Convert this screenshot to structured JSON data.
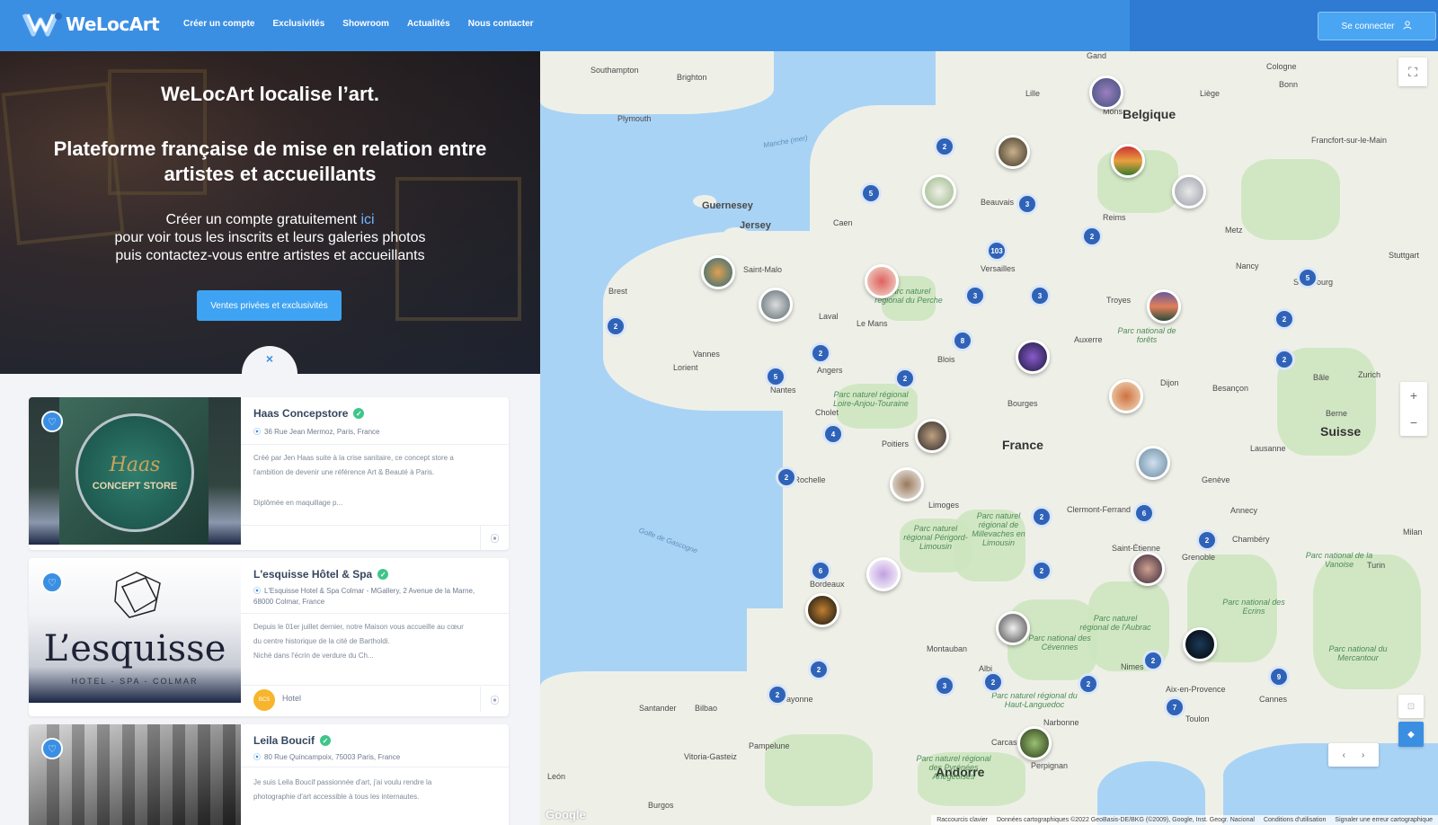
{
  "header": {
    "logo_text": "WeLocArt",
    "nav": [
      "Créer un compte",
      "Exclusivités",
      "Showroom",
      "Actualités",
      "Nous contacter"
    ],
    "login_label": "Se connecter",
    "brand_color": "#3b8fe3"
  },
  "hero": {
    "title": "WeLocArt localise l’art.",
    "subtitle": "Plateforme française de mise en relation entre artistes et accueillants",
    "line1_prefix": "Créer un compte gratuitement ",
    "line1_link": "ici",
    "line2": "pour voir tous les inscrits et leurs galeries photos",
    "line3": "puis contactez-vous entre artistes et accueillants",
    "cta_label": "Ventes privées et exclusivités",
    "close_icon": "×"
  },
  "listings": [
    {
      "name": "Haas Concepstore",
      "address": "36 Rue Jean Mermoz, Paris, France",
      "desc1": "Créé par Jen Haas suite à la crise sanitaire, ce concept store a",
      "desc2": "l'ambition de devenir une référence Art & Beauté à Paris.",
      "desc3": "Diplômée en maquillage p...",
      "image_text": "Haas",
      "image_text2": "CONCEPT STORE"
    },
    {
      "name": "L'esquisse Hôtel & Spa",
      "address": "L'Esquisse Hotel & Spa Colmar - MGallery, 2 Avenue de la Marne, 68000 Colmar, France",
      "desc1": "Depuis le 01er juillet dernier, notre Maison vous accueille au cœur",
      "desc2": "du centre historique de la cité de Bartholdi.",
      "desc3": "Niché dans l'écrin de verdure du Ch...",
      "category": "Hotel",
      "category_badge": "BCS",
      "image_text": "L’esquisse",
      "image_text2": "HOTEL - SPA - COLMAR"
    },
    {
      "name": "Leila Boucif",
      "address": "80 Rue Quincampoix, 75003 Paris, France",
      "desc1": "Je suis Leila Boucif passionnée d'art, j'ai voulu rendre la",
      "desc2": "photographie d'art accessible à tous les internautes."
    }
  ],
  "map": {
    "labels": {
      "france": "France",
      "belgique": "Belgique",
      "suisse": "Suisse",
      "andorre": "Andorre",
      "guernesey": "Guernesey",
      "jersey": "Jersey",
      "paris_area": "Versailles",
      "bordeaux": "Bordeaux",
      "lyon": "Clermont-Ferrand",
      "nantes": "Nantes",
      "rennes": "Saint-Malo",
      "brest": "Brest",
      "toulouse": "Montauban",
      "marseille": "Aix-en-Provence",
      "geneve": "Genève",
      "lausanne": "Lausanne",
      "milan": "Milan",
      "turin": "Turin",
      "bilbao": "Bilbao",
      "cologne": "Cologne",
      "bonn": "Bonn",
      "reims": "Reims",
      "dijon": "Dijon",
      "limoges": "Limoges",
      "poitiers": "Poitiers",
      "angers": "Angers",
      "caen": "Caen",
      "brighton": "Brighton",
      "southampton": "Southampton",
      "plymouth": "Plymouth",
      "metz": "Metz",
      "nancy": "Nancy",
      "strasbourg": "Strasbourg",
      "zurich": "Zurich",
      "besancon": "Besançon",
      "grenoble": "Grenoble",
      "nimes": "Nimes",
      "perpignan": "Perpignan",
      "narbonne": "Narbonne",
      "cannes": "Cannes",
      "toulon": "Toulon",
      "bayonne": "Bayonne",
      "lille": "Lille",
      "amiens": "Beauvais",
      "orleans": "Blois",
      "tours": "Le Mans",
      "vannes": "Vannes",
      "larochelle": "La Rochelle",
      "burgos": "Burgos",
      "pampelune": "Pampelune",
      "gand": "Gand",
      "mons": "Mons",
      "liege": "Liège",
      "frankfurt": "Francfort-sur-le-Main",
      "stuttgart": "Stuttgart",
      "bale": "Bâle",
      "berne": "Berne",
      "manche": "Manche (mer)",
      "gascogne": "Golfe de Gascogne",
      "saint_etienne": "Saint-Étienne",
      "bourges": "Bourges",
      "troyes": "Troyes",
      "annecy": "Annecy",
      "chambery": "Chambéry",
      "albi": "Albi",
      "carcassonne": "Carcassonne",
      "santander": "Santander",
      "vitoria": "Vitoria-Gasteiz",
      "leon": "León",
      "cholet": "Cholet",
      "laval": "Laval",
      "lorient": "Lorient",
      "auxerre": "Auxerre"
    },
    "parks": [
      "Parc naturel régional du Perche",
      "Parc naturel régional Loire-Anjou-Touraine",
      "Parc naturel régional Périgord-Limousin",
      "Parc naturel régional de Millevaches en Limousin",
      "Parc national des Cévennes",
      "Parc naturel régional des Pyrénées Ariégeoises",
      "Parc national du Mercantour",
      "Parc national des Ecrins",
      "Parc naturel régional du Haut-Languedoc",
      "Parc national de la Vanoise",
      "Parc naturel régional de l'Aubrac",
      "Parc national de forêts"
    ],
    "clusters": [
      "2",
      "5",
      "3",
      "103",
      "3",
      "3",
      "2",
      "8",
      "2",
      "2",
      "5",
      "4",
      "2",
      "2",
      "2",
      "6",
      "2",
      "2",
      "6",
      "2",
      "2",
      "2",
      "3",
      "2",
      "2",
      "7",
      "9",
      "2",
      "5",
      "2"
    ],
    "attribution": [
      "Raccourcis clavier",
      "Données cartographiques ©2022 GeoBasis-DE/BKG (©2009), Google, Inst. Geogr. Nacional",
      "Conditions d'utilisation",
      "Signaler une erreur cartographique"
    ],
    "google": "Google",
    "icons": [
      "fullscreen-icon",
      "zoom-in-icon",
      "zoom-out-icon",
      "pegman-icon"
    ]
  }
}
